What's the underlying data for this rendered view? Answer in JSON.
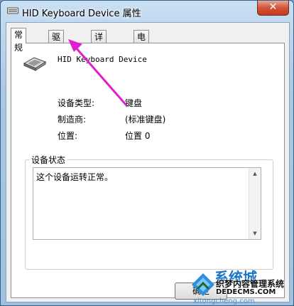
{
  "window": {
    "title": "HID Keyboard Device 属性",
    "close_glyph": "✕"
  },
  "tabs": [
    {
      "label": "常规",
      "active": true
    },
    {
      "label": "驱动程序",
      "active": false
    },
    {
      "label": "详细信息",
      "active": false
    },
    {
      "label": "电源管理",
      "active": false
    }
  ],
  "device": {
    "name": "HID Keyboard Device",
    "icon": "keyboard-icon"
  },
  "properties": [
    {
      "label": "设备类型:",
      "value": "键盘"
    },
    {
      "label": "制造商:",
      "value": "(标准键盘)"
    },
    {
      "label": "位置:",
      "value": "位置 0"
    }
  ],
  "status_group": {
    "title": "设备状态",
    "text": "这个设备运转正常。"
  },
  "buttons": {
    "ok_label": "确定"
  },
  "annotation": {
    "arrow_color": "#e020d0"
  },
  "watermark": {
    "brand": "系统城",
    "line1": "织梦内容管理系统",
    "line2": "DEDECMS.COM",
    "url": "xitongcheng.com"
  }
}
